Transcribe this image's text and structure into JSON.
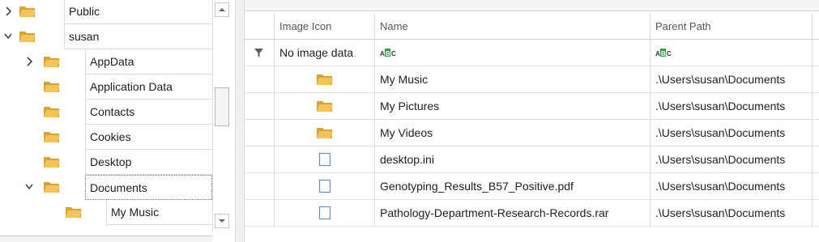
{
  "tree": {
    "items": [
      {
        "label": "Public",
        "expanded": false,
        "has_toggle": true,
        "level": 0,
        "selected": false
      },
      {
        "label": "susan",
        "expanded": true,
        "has_toggle": true,
        "level": 0,
        "selected": false
      },
      {
        "label": "AppData",
        "expanded": false,
        "has_toggle": true,
        "level": 1,
        "selected": false
      },
      {
        "label": "Application Data",
        "expanded": false,
        "has_toggle": false,
        "level": 1,
        "selected": false
      },
      {
        "label": "Contacts",
        "expanded": false,
        "has_toggle": false,
        "level": 1,
        "selected": false
      },
      {
        "label": "Cookies",
        "expanded": false,
        "has_toggle": false,
        "level": 1,
        "selected": false
      },
      {
        "label": "Desktop",
        "expanded": false,
        "has_toggle": false,
        "level": 1,
        "selected": false
      },
      {
        "label": "Documents",
        "expanded": true,
        "has_toggle": true,
        "level": 1,
        "selected": true
      },
      {
        "label": "My Music",
        "expanded": false,
        "has_toggle": false,
        "level": 2,
        "selected": false
      }
    ]
  },
  "grid": {
    "columns": [
      "Image Icon",
      "Name",
      "Parent Path"
    ],
    "filter_row": {
      "image_icon": "No image data"
    },
    "rows": [
      {
        "icon": "folder-icon",
        "name": "My Music",
        "path": ".\\Users\\susan\\Documents"
      },
      {
        "icon": "folder-icon",
        "name": "My Pictures",
        "path": ".\\Users\\susan\\Documents"
      },
      {
        "icon": "folder-icon",
        "name": "My Videos",
        "path": ".\\Users\\susan\\Documents"
      },
      {
        "icon": "file-icon",
        "name": "desktop.ini",
        "path": ".\\Users\\susan\\Documents"
      },
      {
        "icon": "file-icon",
        "name": "Genotyping_Results_B57_Positive.pdf",
        "path": ".\\Users\\susan\\Documents"
      },
      {
        "icon": "file-icon",
        "name": "Pathology-Department-Research-Records.rar",
        "path": ".\\Users\\susan\\Documents"
      }
    ]
  },
  "colors": {
    "folder": "#f2c45a",
    "folder_dark": "#d9a232",
    "abc_green": "#2ea043",
    "file_outline": "#6d8fc4",
    "chevron": "#444444"
  }
}
